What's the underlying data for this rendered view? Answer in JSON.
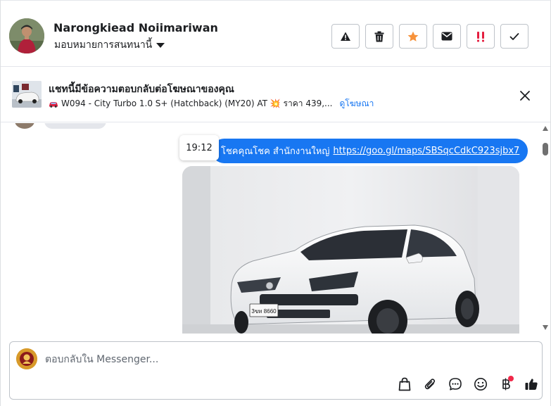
{
  "header": {
    "contact_name": "Narongkiead Noiimariwan",
    "assign_label": "มอบหมายการสนทนานี้",
    "actions": [
      {
        "name": "report-button",
        "icon": "warning-icon"
      },
      {
        "name": "delete-button",
        "icon": "trash-icon"
      },
      {
        "name": "star-button",
        "icon": "star-icon"
      },
      {
        "name": "mark-unread-button",
        "icon": "envelope-icon"
      },
      {
        "name": "spam-button",
        "icon": "double-exclamation-icon"
      },
      {
        "name": "done-button",
        "icon": "check-icon"
      }
    ]
  },
  "ad": {
    "title": "แชทนี้มีข้อความตอบกลับต่อโฆษณาของคุณ",
    "subtitle": "W094 - City Turbo 1.0 S+ (Hatchback) (MY20) AT 💥 ราคา 439,...",
    "view_ad_link": "ดูโฆษณา"
  },
  "messages": {
    "tooltip_time": "19:12",
    "outgoing_text": "โชคคุณโชค สำนักงานใหญ่",
    "outgoing_link": "https://goo.gl/maps/SBSqcCdkC923sjbx7",
    "car_plate": "3ขท 8660"
  },
  "composer": {
    "placeholder": "ตอบกลับใน Messenger..."
  },
  "colors": {
    "accent": "#1877f2",
    "star": "#f7923a",
    "spam": "#e41e3f",
    "badge": "#f02849"
  }
}
